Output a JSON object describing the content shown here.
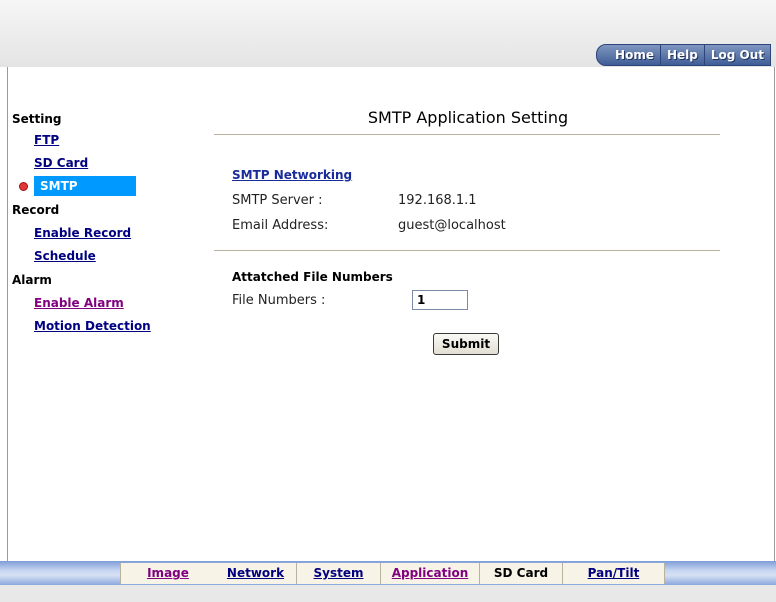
{
  "top_nav": {
    "home": "Home",
    "help": "Help",
    "logout": "Log Out"
  },
  "sidebar": {
    "setting_heading": "Setting",
    "ftp": "FTP",
    "sd_card": "SD Card",
    "smtp": "SMTP",
    "record_heading": "Record",
    "enable_record": "Enable Record",
    "schedule": "Schedule",
    "alarm_heading": "Alarm",
    "enable_alarm": "Enable Alarm",
    "motion_detection": "Motion Detection"
  },
  "main": {
    "title": "SMTP Application Setting",
    "section1": "SMTP Networking",
    "smtp_server_label": "SMTP Server :",
    "smtp_server_value": "192.168.1.1",
    "email_label": "Email Address:",
    "email_value": "guest@localhost",
    "section2": "Attatched File Numbers",
    "file_numbers_label": "File Numbers :",
    "file_numbers_value": "1",
    "submit": "Submit"
  },
  "bottom_tabs": {
    "image": "Image",
    "network": "Network",
    "system": "System",
    "application": "Application",
    "sd_card": "SD Card",
    "pan_tilt": "Pan/Tilt"
  },
  "colors": {
    "nav_button": "#3f5d96",
    "active_item": "#0099ff",
    "link": "#000080",
    "visited_link": "#800080"
  }
}
